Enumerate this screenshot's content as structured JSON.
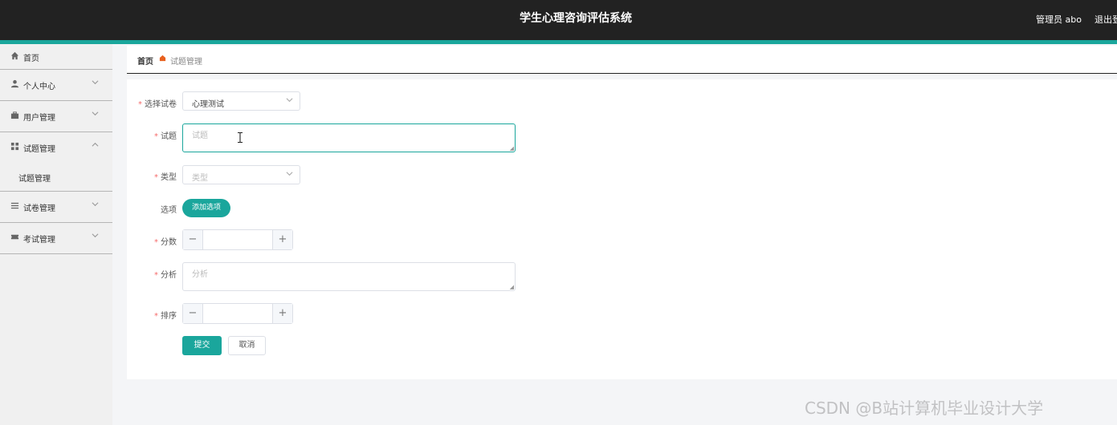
{
  "header": {
    "title": "学生心理咨询评估系统",
    "user_label": "管理员 abo",
    "logout_label": "退出登"
  },
  "sidebar": {
    "items": [
      {
        "icon": "home-icon",
        "label": "首页"
      },
      {
        "icon": "user-icon",
        "label": "个人中心"
      },
      {
        "icon": "briefcase-icon",
        "label": "用户管理"
      },
      {
        "icon": "grid-icon",
        "label": "试题管理",
        "expanded": true,
        "sub_items": [
          {
            "label": "试题管理"
          }
        ]
      },
      {
        "icon": "list-icon",
        "label": "试卷管理"
      },
      {
        "icon": "ticket-icon",
        "label": "考试管理"
      }
    ]
  },
  "breadcrumb": {
    "home": "首页",
    "current": "试题管理"
  },
  "form": {
    "paper": {
      "label": "选择试卷",
      "value": "心理测试"
    },
    "question": {
      "label": "试题",
      "placeholder": "试题"
    },
    "type": {
      "label": "类型",
      "placeholder": "类型"
    },
    "options": {
      "label": "选项",
      "add_button": "添加选项"
    },
    "score": {
      "label": "分数",
      "value": ""
    },
    "analysis": {
      "label": "分析",
      "placeholder": "分析"
    },
    "order": {
      "label": "排序",
      "value": ""
    },
    "submit": "提交",
    "cancel": "取消"
  },
  "watermark": "CSDN @B站计算机毕业设计大学",
  "colors": {
    "header_bg": "#222222",
    "accent": "#1aa69c",
    "required": "#f56c6c",
    "breadcrumb_sep": "#e8611f"
  }
}
